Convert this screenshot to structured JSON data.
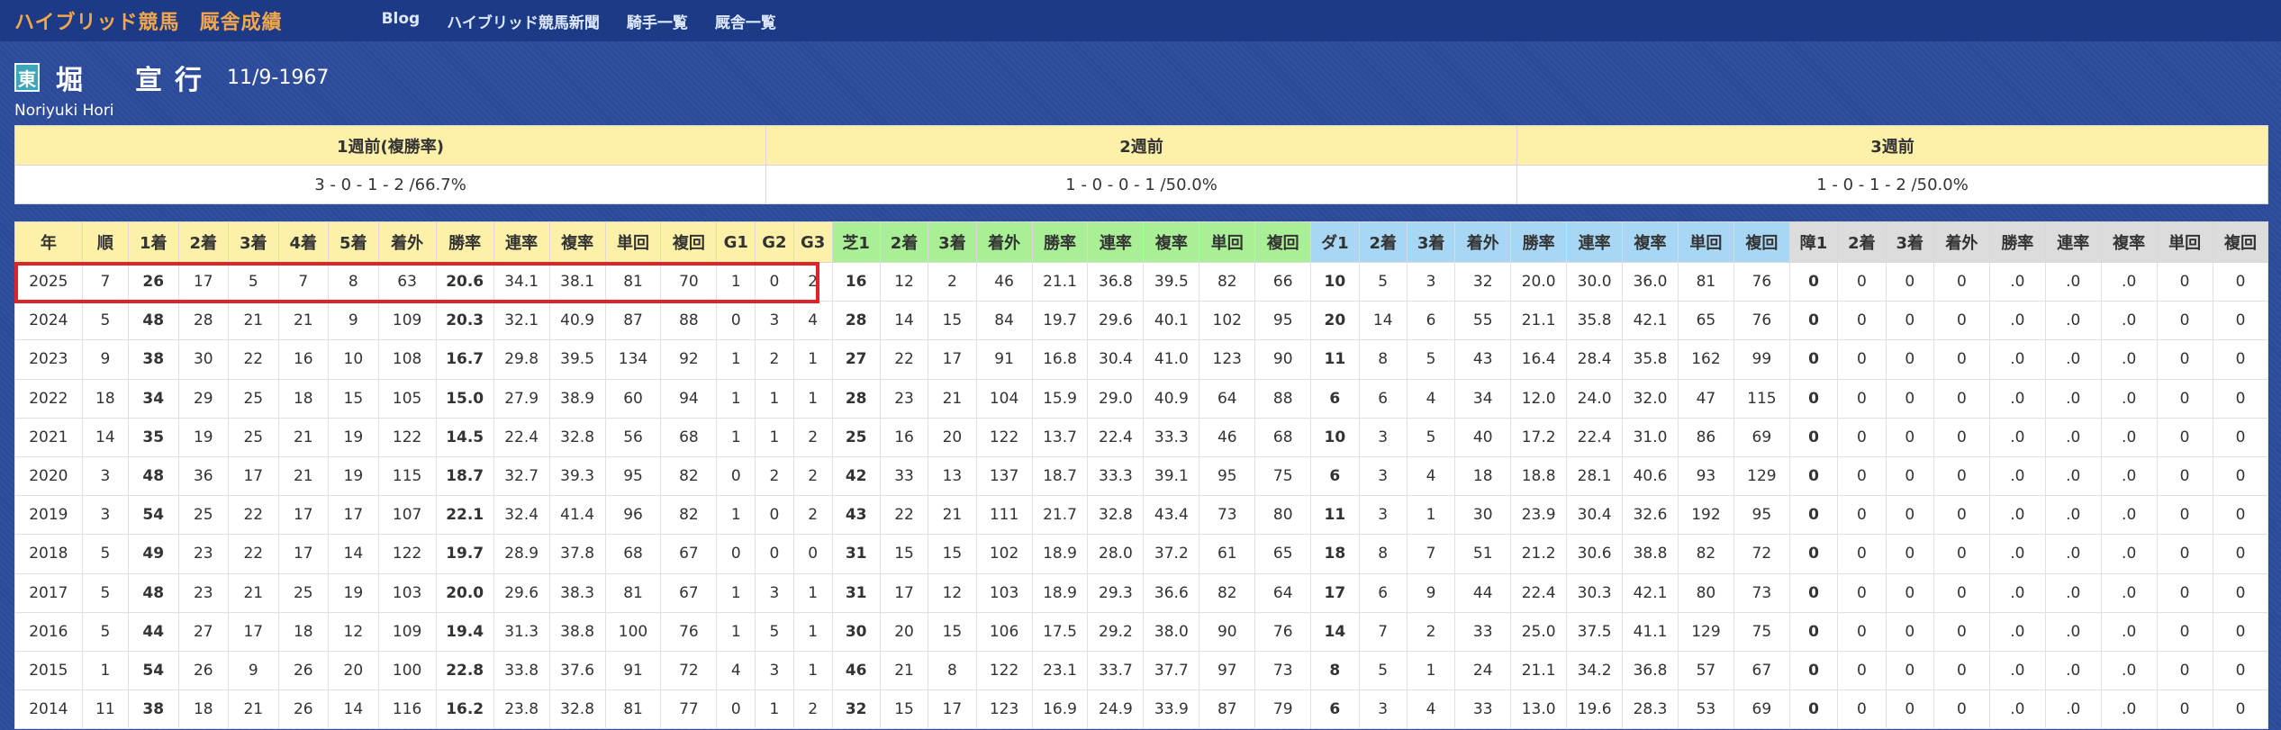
{
  "nav": {
    "brand": "ハイブリッド競馬",
    "brand_sub": "厩舎成績",
    "links": [
      "Blog",
      "ハイブリッド競馬新聞",
      "騎手一覧",
      "厩舎一覧"
    ]
  },
  "trainer": {
    "region": "東",
    "name": "堀　宣行",
    "birth": "11/9-1967",
    "romaji": "Noriyuki Hori"
  },
  "weeks": {
    "headers": [
      "1週前(複勝率)",
      "2週前",
      "3週前"
    ],
    "values": [
      "3 - 0 - 1 - 2 /66.7%",
      "1 - 0 - 0 - 1 /50.0%",
      "1 - 0 - 1 - 2 /50.0%"
    ]
  },
  "stats": {
    "headers": [
      "年",
      "順",
      "1着",
      "2着",
      "3着",
      "4着",
      "5着",
      "着外",
      "勝率",
      "連率",
      "複率",
      "単回",
      "複回",
      "G1",
      "G2",
      "G3",
      "芝1",
      "2着",
      "3着",
      "着外",
      "勝率",
      "連率",
      "複率",
      "単回",
      "複回",
      "ダ1",
      "2着",
      "3着",
      "着外",
      "勝率",
      "連率",
      "複率",
      "単回",
      "複回",
      "障1",
      "2着",
      "3着",
      "着外",
      "勝率",
      "連率",
      "複率",
      "単回",
      "複回"
    ],
    "rows": [
      [
        "2025",
        "7",
        "26",
        "17",
        "5",
        "7",
        "8",
        "63",
        "20.6",
        "34.1",
        "38.1",
        "81",
        "70",
        "1",
        "0",
        "2",
        "16",
        "12",
        "2",
        "46",
        "21.1",
        "36.8",
        "39.5",
        "82",
        "66",
        "10",
        "5",
        "3",
        "32",
        "20.0",
        "30.0",
        "36.0",
        "81",
        "76",
        "0",
        "0",
        "0",
        "0",
        ".0",
        ".0",
        ".0",
        "0",
        "0"
      ],
      [
        "2024",
        "5",
        "48",
        "28",
        "21",
        "21",
        "9",
        "109",
        "20.3",
        "32.1",
        "40.9",
        "87",
        "88",
        "0",
        "3",
        "4",
        "28",
        "14",
        "15",
        "84",
        "19.7",
        "29.6",
        "40.1",
        "102",
        "95",
        "20",
        "14",
        "6",
        "55",
        "21.1",
        "35.8",
        "42.1",
        "65",
        "76",
        "0",
        "0",
        "0",
        "0",
        ".0",
        ".0",
        ".0",
        "0",
        "0"
      ],
      [
        "2023",
        "9",
        "38",
        "30",
        "22",
        "16",
        "10",
        "108",
        "16.7",
        "29.8",
        "39.5",
        "134",
        "92",
        "1",
        "2",
        "1",
        "27",
        "22",
        "17",
        "91",
        "16.8",
        "30.4",
        "41.0",
        "123",
        "90",
        "11",
        "8",
        "5",
        "43",
        "16.4",
        "28.4",
        "35.8",
        "162",
        "99",
        "0",
        "0",
        "0",
        "0",
        ".0",
        ".0",
        ".0",
        "0",
        "0"
      ],
      [
        "2022",
        "18",
        "34",
        "29",
        "25",
        "18",
        "15",
        "105",
        "15.0",
        "27.9",
        "38.9",
        "60",
        "94",
        "1",
        "1",
        "1",
        "28",
        "23",
        "21",
        "104",
        "15.9",
        "29.0",
        "40.9",
        "64",
        "88",
        "6",
        "6",
        "4",
        "34",
        "12.0",
        "24.0",
        "32.0",
        "47",
        "115",
        "0",
        "0",
        "0",
        "0",
        ".0",
        ".0",
        ".0",
        "0",
        "0"
      ],
      [
        "2021",
        "14",
        "35",
        "19",
        "25",
        "21",
        "19",
        "122",
        "14.5",
        "22.4",
        "32.8",
        "56",
        "68",
        "1",
        "1",
        "2",
        "25",
        "16",
        "20",
        "122",
        "13.7",
        "22.4",
        "33.3",
        "46",
        "68",
        "10",
        "3",
        "5",
        "40",
        "17.2",
        "22.4",
        "31.0",
        "86",
        "69",
        "0",
        "0",
        "0",
        "0",
        ".0",
        ".0",
        ".0",
        "0",
        "0"
      ],
      [
        "2020",
        "3",
        "48",
        "36",
        "17",
        "21",
        "19",
        "115",
        "18.7",
        "32.7",
        "39.3",
        "95",
        "82",
        "0",
        "2",
        "2",
        "42",
        "33",
        "13",
        "137",
        "18.7",
        "33.3",
        "39.1",
        "95",
        "75",
        "6",
        "3",
        "4",
        "18",
        "18.8",
        "28.1",
        "40.6",
        "93",
        "129",
        "0",
        "0",
        "0",
        "0",
        ".0",
        ".0",
        ".0",
        "0",
        "0"
      ],
      [
        "2019",
        "3",
        "54",
        "25",
        "22",
        "17",
        "17",
        "107",
        "22.1",
        "32.4",
        "41.4",
        "96",
        "82",
        "1",
        "0",
        "2",
        "43",
        "22",
        "21",
        "111",
        "21.7",
        "32.8",
        "43.4",
        "73",
        "80",
        "11",
        "3",
        "1",
        "30",
        "23.9",
        "30.4",
        "32.6",
        "192",
        "95",
        "0",
        "0",
        "0",
        "0",
        ".0",
        ".0",
        ".0",
        "0",
        "0"
      ],
      [
        "2018",
        "5",
        "49",
        "23",
        "22",
        "17",
        "14",
        "122",
        "19.7",
        "28.9",
        "37.8",
        "68",
        "67",
        "0",
        "0",
        "0",
        "31",
        "15",
        "15",
        "102",
        "18.9",
        "28.0",
        "37.2",
        "61",
        "65",
        "18",
        "8",
        "7",
        "51",
        "21.2",
        "30.6",
        "38.8",
        "82",
        "72",
        "0",
        "0",
        "0",
        "0",
        ".0",
        ".0",
        ".0",
        "0",
        "0"
      ],
      [
        "2017",
        "5",
        "48",
        "23",
        "21",
        "25",
        "19",
        "103",
        "20.0",
        "29.6",
        "38.3",
        "81",
        "67",
        "1",
        "3",
        "1",
        "31",
        "17",
        "12",
        "103",
        "18.9",
        "29.3",
        "36.6",
        "82",
        "64",
        "17",
        "6",
        "9",
        "44",
        "22.4",
        "30.3",
        "42.1",
        "80",
        "73",
        "0",
        "0",
        "0",
        "0",
        ".0",
        ".0",
        ".0",
        "0",
        "0"
      ],
      [
        "2016",
        "5",
        "44",
        "27",
        "17",
        "18",
        "12",
        "109",
        "19.4",
        "31.3",
        "38.8",
        "100",
        "76",
        "1",
        "5",
        "1",
        "30",
        "20",
        "15",
        "106",
        "17.5",
        "29.2",
        "38.0",
        "90",
        "76",
        "14",
        "7",
        "2",
        "33",
        "25.0",
        "37.5",
        "41.1",
        "129",
        "75",
        "0",
        "0",
        "0",
        "0",
        ".0",
        ".0",
        ".0",
        "0",
        "0"
      ],
      [
        "2015",
        "1",
        "54",
        "26",
        "9",
        "26",
        "20",
        "100",
        "22.8",
        "33.8",
        "37.6",
        "91",
        "72",
        "4",
        "3",
        "1",
        "46",
        "21",
        "8",
        "122",
        "23.1",
        "33.7",
        "37.7",
        "97",
        "73",
        "8",
        "5",
        "1",
        "24",
        "21.1",
        "34.2",
        "36.8",
        "57",
        "67",
        "0",
        "0",
        "0",
        "0",
        ".0",
        ".0",
        ".0",
        "0",
        "0"
      ],
      [
        "2014",
        "11",
        "38",
        "18",
        "21",
        "26",
        "14",
        "116",
        "16.2",
        "23.8",
        "32.8",
        "81",
        "77",
        "0",
        "1",
        "2",
        "32",
        "15",
        "17",
        "123",
        "16.9",
        "24.9",
        "33.9",
        "87",
        "79",
        "6",
        "3",
        "4",
        "33",
        "13.0",
        "19.6",
        "28.3",
        "53",
        "69",
        "0",
        "0",
        "0",
        "0",
        ".0",
        ".0",
        ".0",
        "0",
        "0"
      ]
    ]
  },
  "colors": {
    "total": "#fdf0a8",
    "turf": "#a8ef96",
    "dirt": "#a8d6f5",
    "jump": "#dcdcdc",
    "highlight": "#e0222b"
  }
}
